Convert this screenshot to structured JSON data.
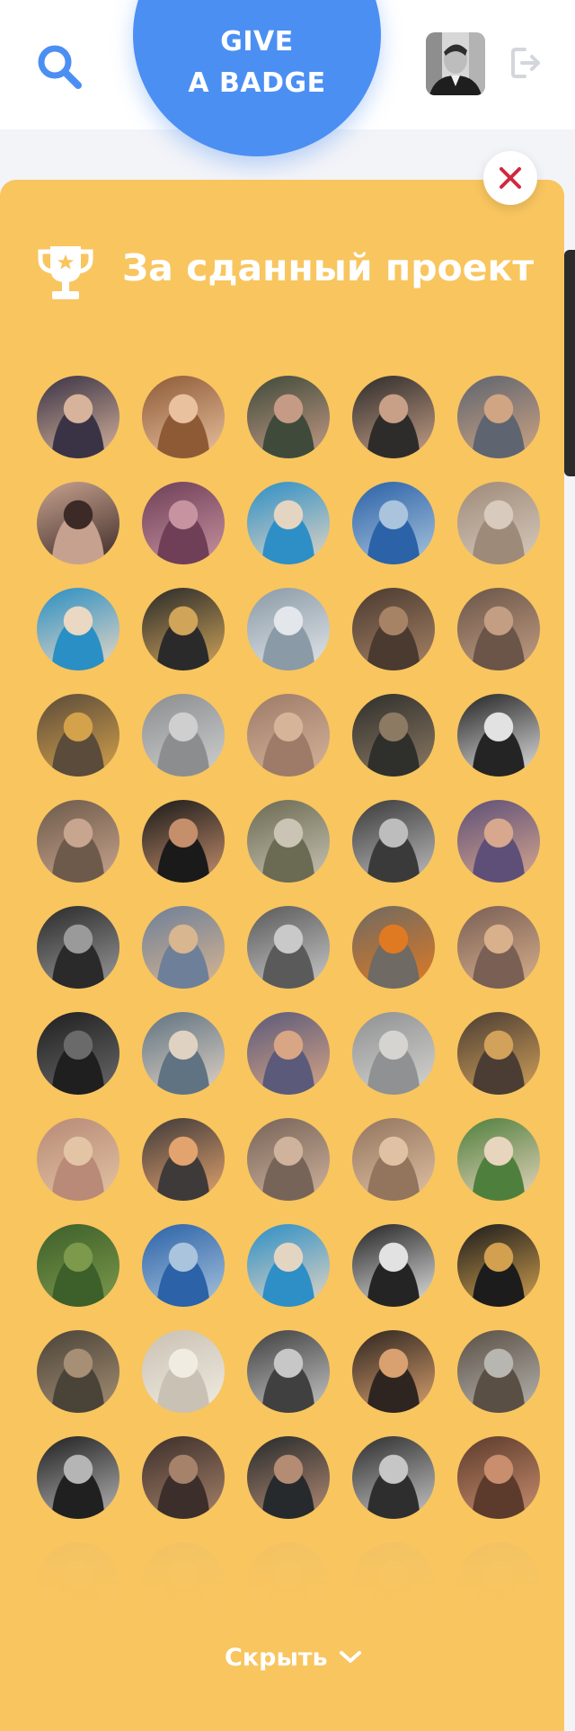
{
  "header": {
    "give_badge_line1": "GIVE",
    "give_badge_line2": "A BADGE",
    "search_icon": "search-icon",
    "logout_icon": "logout-icon",
    "accent_color": "#4b8ff3"
  },
  "panel": {
    "title": "За сданный проект",
    "icon": "trophy-icon",
    "background_color": "#f8c55f",
    "close_icon": "close-icon",
    "close_icon_color": "#d1283e",
    "hide_label": "Скрыть",
    "hide_icon": "chevron-down-icon"
  },
  "people": [
    {
      "c1": "#3a3346",
      "c2": "#d7b39b"
    },
    {
      "c1": "#8e5a36",
      "c2": "#e9c19f"
    },
    {
      "c1": "#3f4a3a",
      "c2": "#c59b86"
    },
    {
      "c1": "#2e2c2b",
      "c2": "#c7a087"
    },
    {
      "c1": "#5e6470",
      "c2": "#d0a583"
    },
    {
      "c1": "#c7a18f",
      "c2": "#3b2a26"
    },
    {
      "c1": "#6e3f57",
      "c2": "#c893a0"
    },
    {
      "c1": "#2d8fc6",
      "c2": "#e4d5c2"
    },
    {
      "c1": "#2b62a8",
      "c2": "#a9c4dc"
    },
    {
      "c1": "#9e8a79",
      "c2": "#d8cbbd"
    },
    {
      "c1": "#2a8fc4",
      "c2": "#ead8c3"
    },
    {
      "c1": "#2a2a2a",
      "c2": "#d0a55a"
    },
    {
      "c1": "#8a9aa6",
      "c2": "#e3e6ea"
    },
    {
      "c1": "#4a3a30",
      "c2": "#a78366"
    },
    {
      "c1": "#6a5548",
      "c2": "#c49e83"
    },
    {
      "c1": "#5b4b3b",
      "c2": "#d4a24a"
    },
    {
      "c1": "#8b8d8f",
      "c2": "#cfcfcf"
    },
    {
      "c1": "#9d7b68",
      "c2": "#d6b49a"
    },
    {
      "c1": "#2f2f2c",
      "c2": "#8c7a63"
    },
    {
      "c1": "#242424",
      "c2": "#e2e2e2"
    },
    {
      "c1": "#6d5a4a",
      "c2": "#c8a58e"
    },
    {
      "c1": "#1a1a1a",
      "c2": "#c58f6c"
    },
    {
      "c1": "#6b6a52",
      "c2": "#c9c4b4"
    },
    {
      "c1": "#3a3a3a",
      "c2": "#bdbdbd"
    },
    {
      "c1": "#5e4f78",
      "c2": "#d7a88e"
    },
    {
      "c1": "#2a2a2a",
      "c2": "#9a9a9a"
    },
    {
      "c1": "#6e7f99",
      "c2": "#d8b690"
    },
    {
      "c1": "#5a5a5a",
      "c2": "#c9c9c9"
    },
    {
      "c1": "#6f6a63",
      "c2": "#e07a22"
    },
    {
      "c1": "#7a5f55",
      "c2": "#d8b08c"
    },
    {
      "c1": "#1f1f1f",
      "c2": "#6a6a6a"
    },
    {
      "c1": "#5f7382",
      "c2": "#e0d2c3"
    },
    {
      "c1": "#5b5a7a",
      "c2": "#d8a585"
    },
    {
      "c1": "#8f9192",
      "c2": "#d5d4d0"
    },
    {
      "c1": "#4b3d33",
      "c2": "#d2a15a"
    },
    {
      "c1": "#b88a77",
      "c2": "#e3c4a4"
    },
    {
      "c1": "#3f3a3a",
      "c2": "#e3a36e"
    },
    {
      "c1": "#776459",
      "c2": "#d0b39c"
    },
    {
      "c1": "#93755e",
      "c2": "#e0c1a3"
    },
    {
      "c1": "#4f7f3c",
      "c2": "#e7d5be"
    },
    {
      "c1": "#3d5f2a",
      "c2": "#7d9a4c"
    },
    {
      "c1": "#2b62a8",
      "c2": "#a9c4dc"
    },
    {
      "c1": "#2d8fc6",
      "c2": "#e4d5c2"
    },
    {
      "c1": "#242424",
      "c2": "#e2e2e2"
    },
    {
      "c1": "#1c1c1c",
      "c2": "#d2a04f"
    },
    {
      "c1": "#4a4338",
      "c2": "#a68f74"
    },
    {
      "c1": "#c9c1b3",
      "c2": "#f1ece2"
    },
    {
      "c1": "#404040",
      "c2": "#c7c7c7"
    },
    {
      "c1": "#2e2520",
      "c2": "#d9a16f"
    },
    {
      "c1": "#5a4f45",
      "c2": "#b8b6b0"
    },
    {
      "c1": "#202020",
      "c2": "#b5b5b5"
    },
    {
      "c1": "#3c2e2a",
      "c2": "#a6826a"
    },
    {
      "c1": "#262a2c",
      "c2": "#b48b73"
    },
    {
      "c1": "#2e2e2e",
      "c2": "#c6c6c6"
    },
    {
      "c1": "#5c3b2c",
      "c2": "#c98e6e"
    },
    {
      "c1": "#c7a67a",
      "c2": "#e8d2b0"
    },
    {
      "c1": "#c7a67a",
      "c2": "#e8d2b0"
    },
    {
      "c1": "#c7a67a",
      "c2": "#e8d2b0"
    },
    {
      "c1": "#c7a67a",
      "c2": "#e8d2b0"
    },
    {
      "c1": "#c7a67a",
      "c2": "#e8d2b0"
    }
  ]
}
